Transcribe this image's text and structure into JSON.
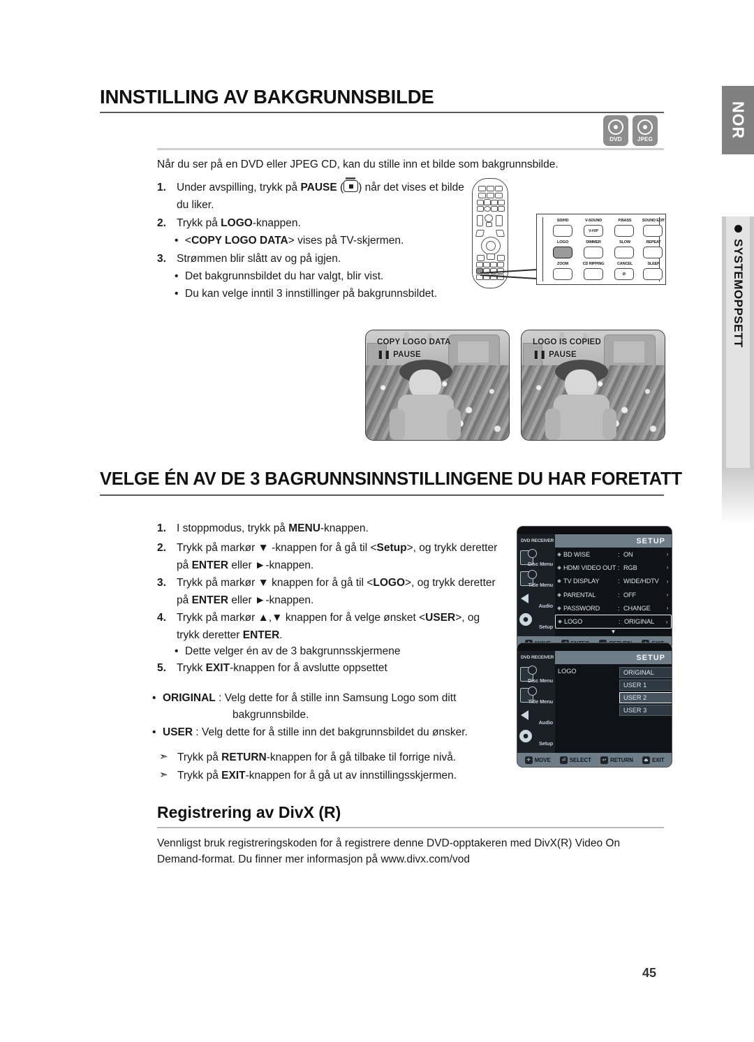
{
  "page": {
    "number": "45",
    "side_tabs": {
      "language": "NOR",
      "section": "SYSTEMOPPSETT"
    }
  },
  "media_badges": [
    {
      "icon": "disc-icon",
      "label": "DVD"
    },
    {
      "icon": "disc-icon",
      "label": "JPEG"
    }
  ],
  "section1": {
    "heading": "INNSTILLING AV BAKGRUNNSBILDE",
    "intro": "Når du ser på en DVD eller JPEG CD, kan du stille inn et bilde som bakgrunnsbilde.",
    "steps": [
      {
        "num": "1.",
        "pre": "Under avspilling, trykk på ",
        "bold": "PAUSE",
        "post": " ( ) når det vises et bilde du liker."
      },
      {
        "num": "2.",
        "pre": "Trykk på ",
        "bold": "LOGO",
        "post": "-knappen."
      },
      {
        "num": "3.",
        "pre": "Strømmen blir slått av og på igjen.",
        "bold": "",
        "post": ""
      }
    ],
    "sub_2": {
      "dot": "•",
      "pre": "<",
      "bold": "COPY LOGO DATA",
      "post": "> vises på TV-skjermen."
    },
    "sub_3a": {
      "dot": "•",
      "text": "Det bakgrunnsbildet du har valgt, blir vist."
    },
    "sub_3b": {
      "dot": "•",
      "text": "Du kan velge inntil 3 innstillinger på bakgrunnsbildet."
    }
  },
  "remote": {
    "highlight_button": "LOGO",
    "callout_rows": [
      [
        "SD/HD",
        "V-SOUND",
        "P.BASS",
        "SOUND EDIT"
      ],
      [
        "LOGO",
        "DIMMER",
        "SLOW",
        "REPEAT"
      ],
      [
        "ZOOM",
        "CD RIPPING",
        "CANCEL",
        "SLEEP"
      ]
    ],
    "inner_labels": {
      "vsound": "V-H/P",
      "cancel": "Ø"
    }
  },
  "tv_screens": [
    {
      "name": "copy-logo-data-screen",
      "line1": "COPY LOGO DATA",
      "line2": "PAUSE",
      "pause_icon": "❚❚"
    },
    {
      "name": "logo-is-copied-screen",
      "line1": "LOGO IS COPIED",
      "line2": "PAUSE",
      "pause_icon": "❚❚"
    }
  ],
  "section2": {
    "heading": "VELGE ÉN AV DE 3 BAGRUNNSINNSTILLINGENE DU HAR FORETATT",
    "steps": [
      {
        "num": "1.",
        "parts": [
          {
            "t": "I stoppmodus, trykk på ",
            "b": false
          },
          {
            "t": "MENU",
            "b": true
          },
          {
            "t": "-knappen.",
            "b": false
          }
        ]
      },
      {
        "num": "2.",
        "parts": [
          {
            "t": "Trykk på markør ▼ -knappen for å gå til <",
            "b": false
          },
          {
            "t": "Setup",
            "b": true
          },
          {
            "t": ">, og trykk deretter på ",
            "b": false
          },
          {
            "t": "ENTER",
            "b": true
          },
          {
            "t": " eller ►-knappen.",
            "b": false
          }
        ]
      },
      {
        "num": "3.",
        "parts": [
          {
            "t": "Trykk på markør ▼ knappen for å gå til <",
            "b": false
          },
          {
            "t": "LOGO",
            "b": true
          },
          {
            "t": ">, og trykk deretter på ",
            "b": false
          },
          {
            "t": "ENTER",
            "b": true
          },
          {
            "t": " eller ►-knappen.",
            "b": false
          }
        ]
      },
      {
        "num": "4.",
        "parts": [
          {
            "t": "Trykk på markør ▲,▼ knappen for å velge ønsket <",
            "b": false
          },
          {
            "t": "USER",
            "b": true
          },
          {
            "t": ">, og trykk deretter ",
            "b": false
          },
          {
            "t": "ENTER",
            "b": true
          },
          {
            "t": ".",
            "b": false
          }
        ]
      },
      {
        "num": "5.",
        "parts": [
          {
            "t": "Trykk ",
            "b": false
          },
          {
            "t": "EXIT",
            "b": true
          },
          {
            "t": "-knappen for å avslutte oppsettet",
            "b": false
          }
        ]
      }
    ],
    "step4_sub": {
      "dot": "•",
      "text": "Dette velger én av de 3 bakgrunnsskjermene"
    },
    "bullets": [
      {
        "dot": "•",
        "bold": "ORIGINAL",
        "rest": " : Velg dette for å stille inn Samsung Logo som ditt",
        "cont": "bakgrunnsbilde."
      },
      {
        "dot": "•",
        "bold": "USER",
        "rest": " : Velg dette for å stille inn det bakgrunnsbildet du ønsker.",
        "cont": ""
      }
    ],
    "notes": [
      {
        "arrow": "➣",
        "pre": "Trykk på ",
        "bold": "RETURN",
        "post": "-knappen for å gå tilbake til forrige nivå."
      },
      {
        "arrow": "➣",
        "pre": "Trykk på ",
        "bold": "EXIT",
        "post": "-knappen for å gå ut av innstillingsskjermen."
      }
    ]
  },
  "osd_setup": {
    "receiver_label": "DVD RECEIVER",
    "title": "SETUP",
    "sidebar": [
      {
        "icon": "disc-menu-icon",
        "label": "Disc Menu"
      },
      {
        "icon": "title-menu-icon",
        "label": "Title Menu"
      },
      {
        "icon": "speaker-icon",
        "label": "Audio"
      },
      {
        "icon": "gear-icon",
        "label": "Setup"
      }
    ],
    "rows": [
      {
        "name": "BD WISE",
        "sep": ":",
        "value": "ON",
        "arrow": "›"
      },
      {
        "name": "HDMI VIDEO OUT",
        "sep": ":",
        "value": "RGB",
        "arrow": "›"
      },
      {
        "name": "TV DISPLAY",
        "sep": ":",
        "value": "WIDE/HDTV",
        "arrow": "›"
      },
      {
        "name": "PARENTAL",
        "sep": ":",
        "value": "OFF",
        "arrow": "›"
      },
      {
        "name": "PASSWORD",
        "sep": ":",
        "value": "CHANGE",
        "arrow": "›"
      },
      {
        "name": "LOGO",
        "sep": ":",
        "value": "ORIGINAL",
        "arrow": "›",
        "highlighted": true
      }
    ],
    "more_indicator": "▼",
    "footer": [
      {
        "key": "✛",
        "label": "MOVE"
      },
      {
        "key": "⏎",
        "label": "ENTER"
      },
      {
        "key": "↩",
        "label": "RETURN"
      },
      {
        "key": "⏏",
        "label": "EXIT"
      }
    ]
  },
  "osd_logo": {
    "receiver_label": "DVD RECEIVER",
    "title": "SETUP",
    "sidebar": [
      {
        "icon": "disc-menu-icon",
        "label": "Disc Menu"
      },
      {
        "icon": "title-menu-icon",
        "label": "Title Menu"
      },
      {
        "icon": "speaker-icon",
        "label": "Audio"
      },
      {
        "icon": "gear-icon",
        "label": "Setup"
      }
    ],
    "field_label": "LOGO",
    "options": [
      {
        "label": "ORIGINAL",
        "selected": false
      },
      {
        "label": "USER 1",
        "selected": false
      },
      {
        "label": "USER 2",
        "selected": true
      },
      {
        "label": "USER 3",
        "selected": false
      }
    ],
    "footer": [
      {
        "key": "✛",
        "label": "MOVE"
      },
      {
        "key": "⏎",
        "label": "SELECT"
      },
      {
        "key": "↩",
        "label": "RETURN"
      },
      {
        "key": "⏏",
        "label": "EXIT"
      }
    ]
  },
  "section3": {
    "heading": "Registrering av DivX (R)",
    "body_line1": "Vennligst bruk registreringskoden for å registrere denne DVD-opptakeren med DivX(R) Video On",
    "body_line2": "Demand-format. Du finner mer informasjon på www.divx.com/vod"
  }
}
